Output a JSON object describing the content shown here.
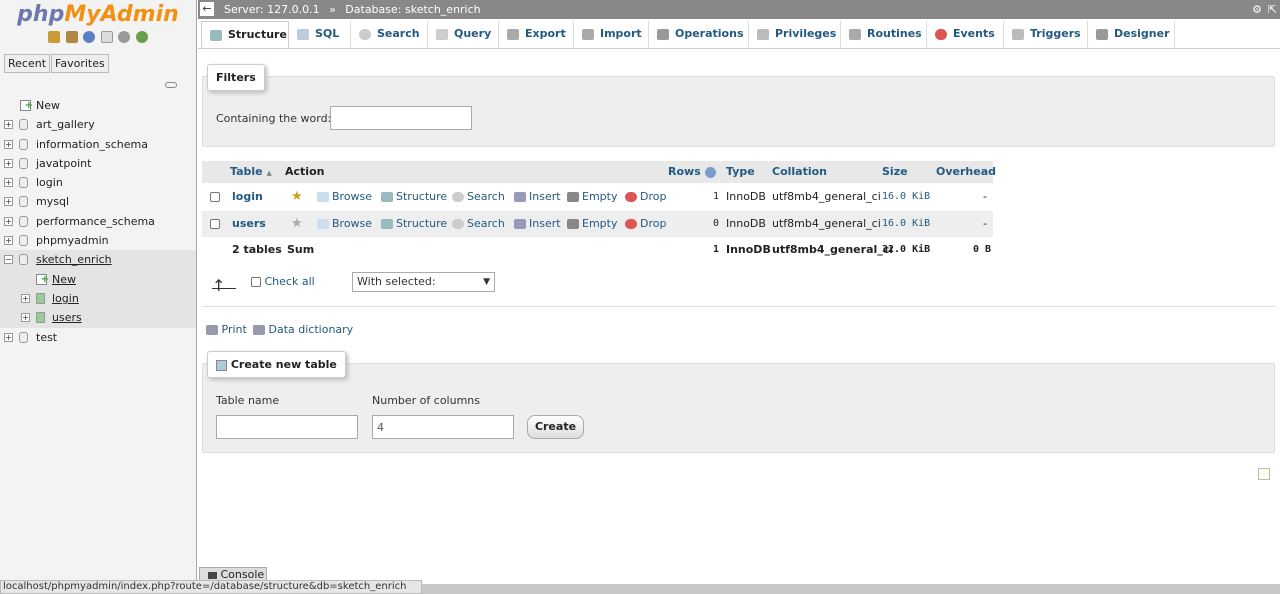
{
  "logo": {
    "php": "php",
    "my": "MyAdmin"
  },
  "nav": {
    "tabs": [
      "Recent",
      "Favorites"
    ],
    "tree": [
      {
        "label": "New"
      },
      {
        "label": "art_gallery"
      },
      {
        "label": "information_schema"
      },
      {
        "label": "javatpoint"
      },
      {
        "label": "login"
      },
      {
        "label": "mysql"
      },
      {
        "label": "performance_schema"
      },
      {
        "label": "phpmyadmin"
      },
      {
        "label": "sketch_enrich"
      },
      {
        "label": "New"
      },
      {
        "label": "login"
      },
      {
        "label": "users"
      },
      {
        "label": "test"
      }
    ]
  },
  "topbar": {
    "server": "Server: 127.0.0.1",
    "sep": "»",
    "database": "Database: sketch_enrich"
  },
  "menu": [
    {
      "label": "Structure"
    },
    {
      "label": "SQL"
    },
    {
      "label": "Search"
    },
    {
      "label": "Query"
    },
    {
      "label": "Export"
    },
    {
      "label": "Import"
    },
    {
      "label": "Operations"
    },
    {
      "label": "Privileges"
    },
    {
      "label": "Routines"
    },
    {
      "label": "Events"
    },
    {
      "label": "Triggers"
    },
    {
      "label": "Designer"
    }
  ],
  "filters": {
    "legend": "Filters",
    "label": "Containing the word:",
    "value": ""
  },
  "table": {
    "headers": {
      "table": "Table",
      "sort": "▲",
      "action": "Action",
      "rows": "Rows",
      "type": "Type",
      "collation": "Collation",
      "size": "Size",
      "overhead": "Overhead"
    },
    "actions": [
      "Browse",
      "Structure",
      "Search",
      "Insert",
      "Empty",
      "Drop"
    ],
    "rows": [
      {
        "name": "login",
        "rows": "1",
        "type": "InnoDB",
        "collation": "utf8mb4_general_ci",
        "size": "16.0 KiB",
        "overhead": "-"
      },
      {
        "name": "users",
        "rows": "0",
        "type": "InnoDB",
        "collation": "utf8mb4_general_ci",
        "size": "16.0 KiB",
        "overhead": "-"
      }
    ],
    "summary": {
      "name": "2 tables",
      "action": "Sum",
      "rows": "1",
      "type": "InnoDB",
      "collation": "utf8mb4_general_ci",
      "size": "32.0 KiB",
      "overhead": "0 B"
    }
  },
  "bulk": {
    "check_all": "Check all",
    "with_selected": "With selected:"
  },
  "links": {
    "print": "Print",
    "dictionary": "Data dictionary"
  },
  "create": {
    "legend": "Create new table",
    "name_label": "Table name",
    "name_value": "",
    "cols_label": "Number of columns",
    "cols_value": "4",
    "button": "Create"
  },
  "console": "Console",
  "status": "localhost/phpmyadmin/index.php?route=/database/structure&db=sketch_enrich"
}
